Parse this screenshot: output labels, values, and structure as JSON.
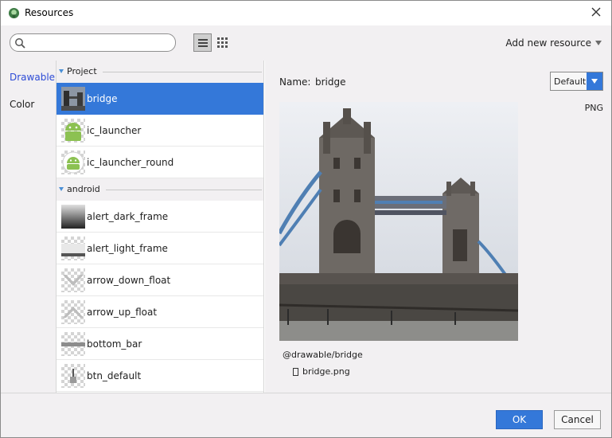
{
  "window": {
    "title": "Resources",
    "app_icon": "android-studio-icon",
    "close_icon": "close-icon"
  },
  "toolbar": {
    "search": {
      "value": "",
      "placeholder": ""
    },
    "view_list_icon": "list-view-icon",
    "view_grid_icon": "grid-view-icon",
    "add_new_resource": "Add new resource"
  },
  "categories": [
    {
      "label": "Drawable",
      "active": true
    },
    {
      "label": "Color",
      "active": false
    }
  ],
  "resources": {
    "project": {
      "label": "Project",
      "items": [
        {
          "label": "bridge",
          "selected": true,
          "thumb": "bridge-photo"
        },
        {
          "label": "ic_launcher",
          "thumb": "android-launcher-icon"
        },
        {
          "label": "ic_launcher_round",
          "thumb": "android-launcher-round-icon"
        }
      ]
    },
    "android": {
      "label": "android",
      "items": [
        {
          "label": "alert_dark_frame",
          "thumb": "dark-frame"
        },
        {
          "label": "alert_light_frame",
          "thumb": "light-frame"
        },
        {
          "label": "arrow_down_float",
          "thumb": "arrow-down"
        },
        {
          "label": "arrow_up_float",
          "thumb": "arrow-up"
        },
        {
          "label": "bottom_bar",
          "thumb": "bottom-bar"
        },
        {
          "label": "btn_default",
          "thumb": "btn-default"
        }
      ]
    }
  },
  "detail": {
    "name_label": "Name:",
    "name_value": "bridge",
    "density": "Default",
    "format": "PNG",
    "reference": "@drawable/bridge",
    "file": "bridge.png"
  },
  "footer": {
    "ok": "OK",
    "cancel": "Cancel"
  },
  "colors": {
    "accent": "#3478d9",
    "active_category": "#2d4bd6",
    "panel_bg": "#f2f0f2"
  }
}
